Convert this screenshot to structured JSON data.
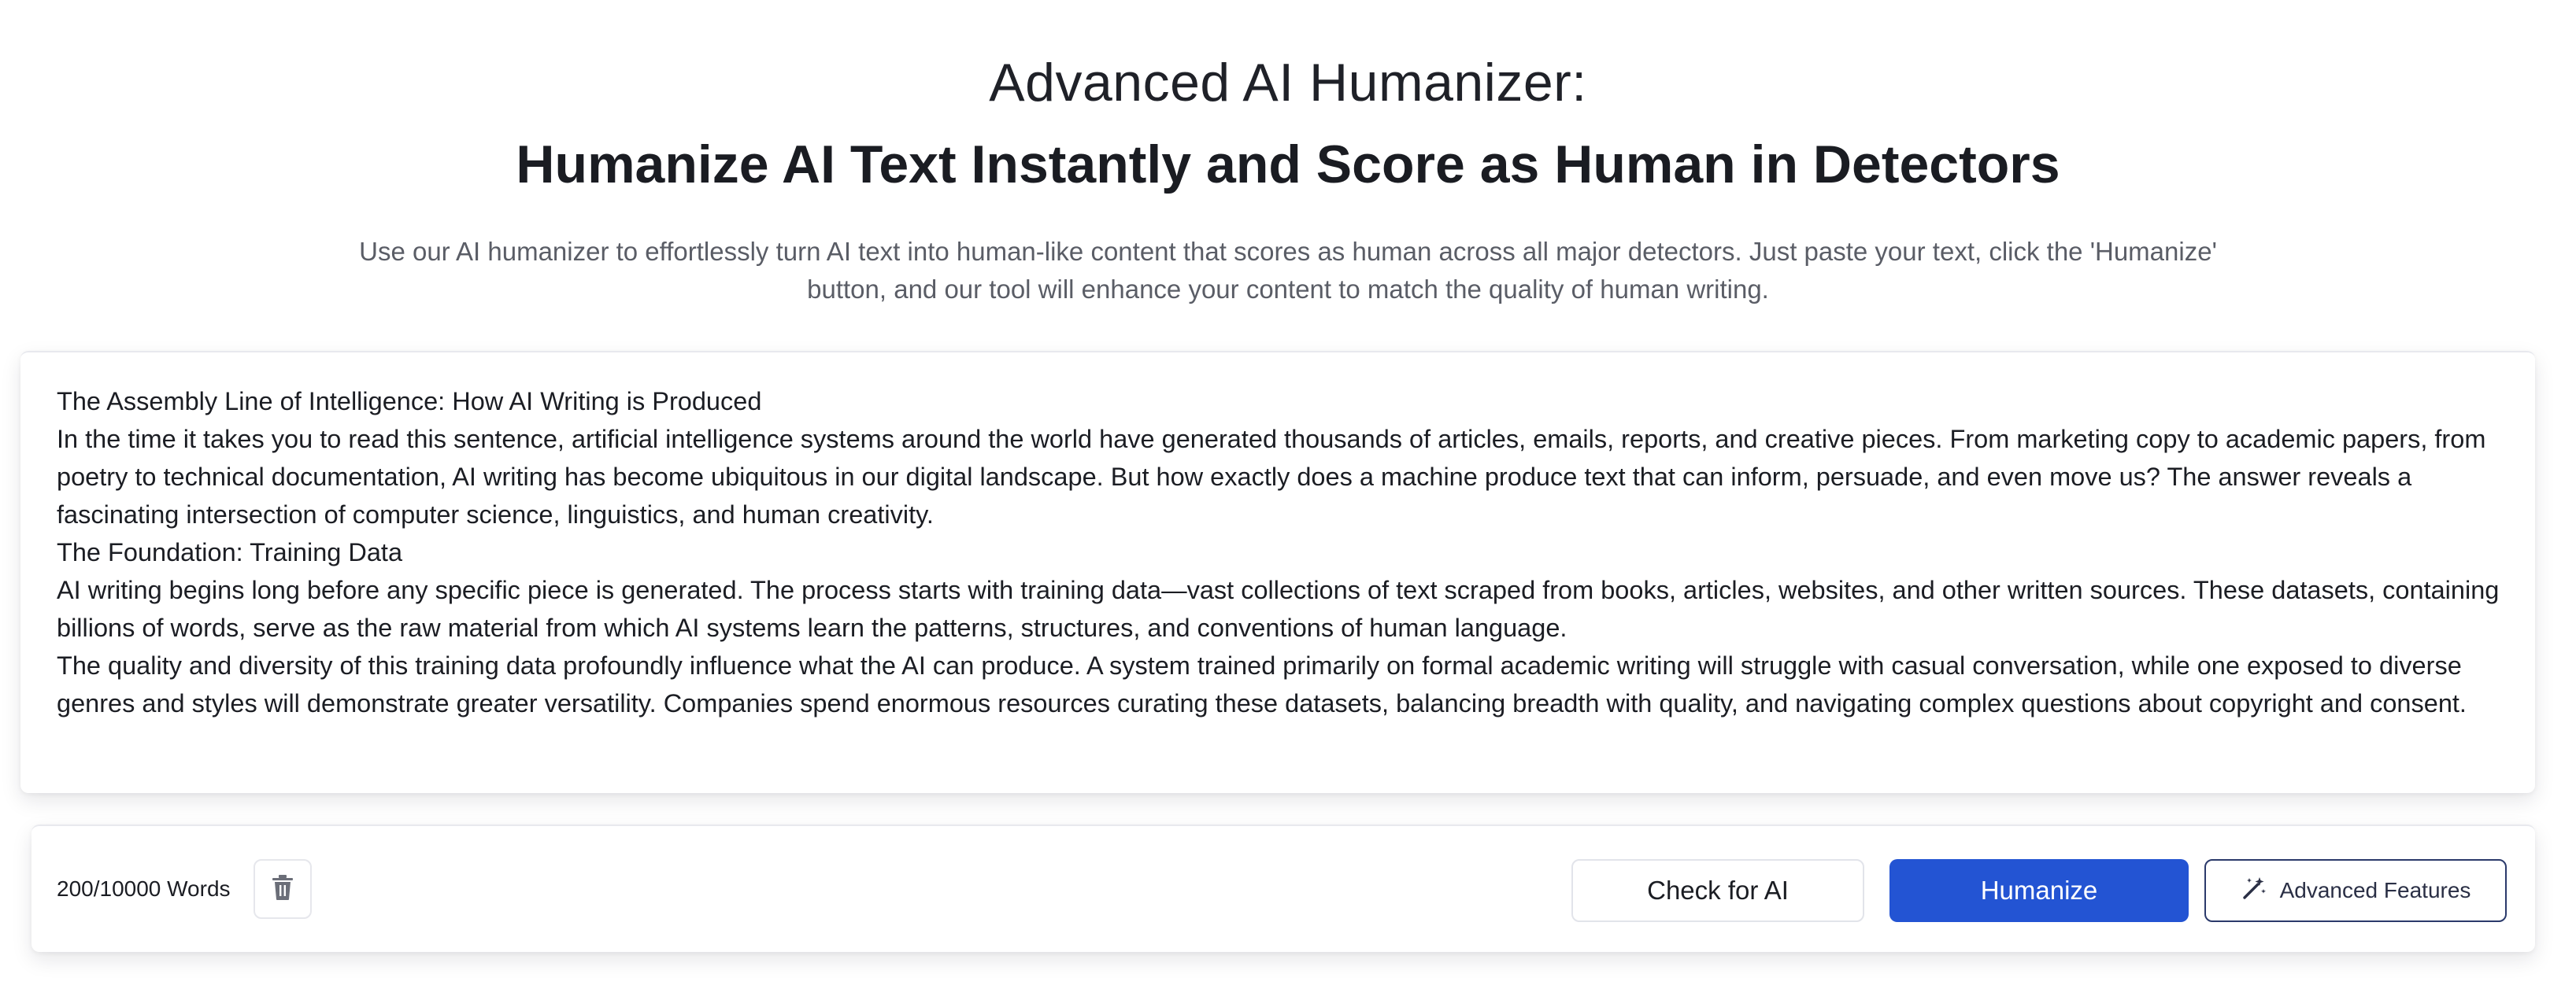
{
  "hero": {
    "title_line1": "Advanced AI Humanizer:",
    "title_line2": "Humanize AI Text Instantly and Score as Human in Detectors",
    "description": "Use our AI humanizer to effortlessly turn AI text into human-like content that scores as human across all major detectors. Just paste your text, click the 'Humanize' button, and our tool will enhance your content to match the quality of human writing."
  },
  "editor": {
    "paragraphs": [
      "The Assembly Line of Intelligence: How AI Writing is Produced",
      "In the time it takes you to read this sentence, artificial intelligence systems around the world have generated thousands of articles, emails, reports, and creative pieces. From marketing copy to academic papers, from poetry to technical documentation, AI writing has become ubiquitous in our digital landscape. But how exactly does a machine produce text that can inform, persuade, and even move us? The answer reveals a fascinating intersection of computer science, linguistics, and human creativity.",
      "The Foundation: Training Data",
      "AI writing begins long before any specific piece is generated. The process starts with training data—vast collections of text scraped from books, articles, websites, and other written sources. These datasets, containing billions of words, serve as the raw material from which AI systems learn the patterns, structures, and conventions of human language.",
      "The quality and diversity of this training data profoundly influence what the AI can produce. A system trained primarily on formal academic writing will struggle with casual conversation, while one exposed to diverse genres and styles will demonstrate greater versatility. Companies spend enormous resources curating these datasets, balancing breadth with quality, and navigating complex questions about copyright and consent."
    ]
  },
  "toolbar": {
    "word_count": "200/10000 Words",
    "delete_icon": "trash-icon",
    "check_label": "Check for AI",
    "humanize_label": "Humanize",
    "advanced_label": "Advanced Features",
    "advanced_icon": "magic-wand-icon"
  },
  "colors": {
    "primary": "#2354d3",
    "text": "#1b1d23",
    "muted": "#5a5d66",
    "border": "#e2e4ea"
  }
}
